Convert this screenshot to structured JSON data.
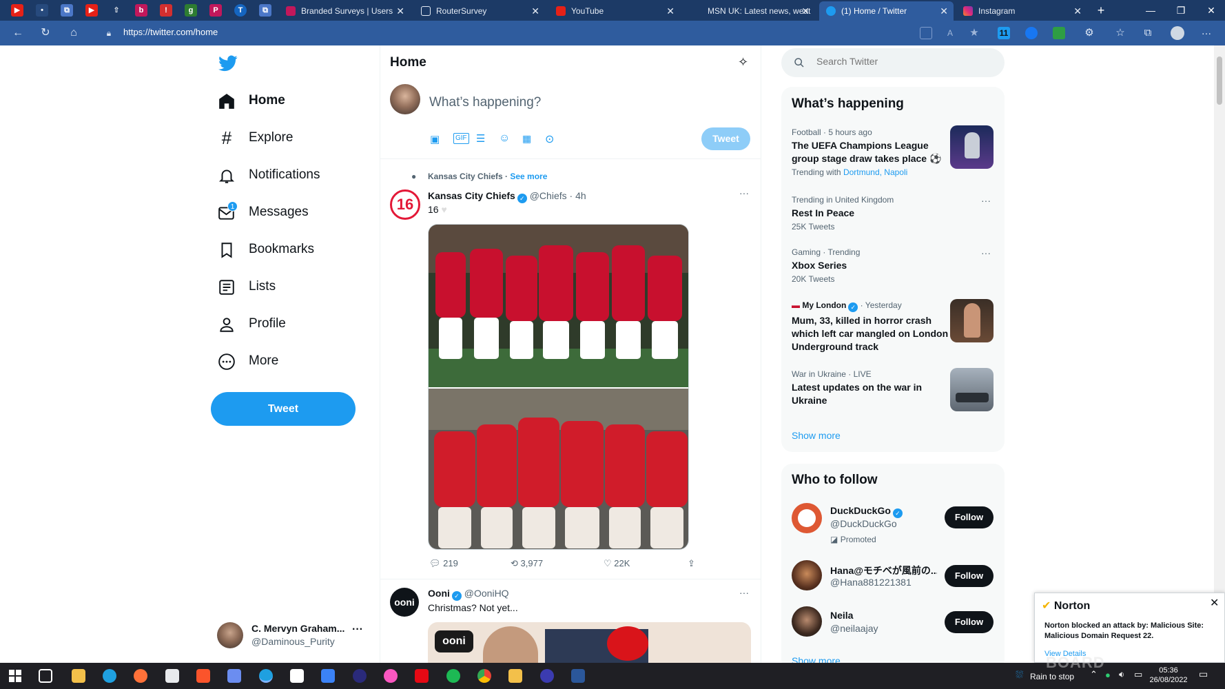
{
  "browser": {
    "tabs": [
      {
        "title": "Branded Surveys | Users",
        "icon": "branded-surveys-icon"
      },
      {
        "title": "RouterSurvey",
        "icon": "document-icon"
      },
      {
        "title": "YouTube",
        "icon": "youtube-icon"
      },
      {
        "title": "MSN UK: Latest news, weat",
        "icon": "msn-icon"
      },
      {
        "title": "(1) Home / Twitter",
        "icon": "twitter-icon",
        "active": true
      },
      {
        "title": "Instagram",
        "icon": "instagram-icon"
      }
    ],
    "url": "https://twitter.com/home"
  },
  "sidebar": {
    "nav": [
      {
        "label": "Home",
        "icon": "home-icon"
      },
      {
        "label": "Explore",
        "icon": "hashtag-icon"
      },
      {
        "label": "Notifications",
        "icon": "bell-icon"
      },
      {
        "label": "Messages",
        "icon": "envelope-icon",
        "badge": "1"
      },
      {
        "label": "Bookmarks",
        "icon": "bookmark-icon"
      },
      {
        "label": "Lists",
        "icon": "list-icon"
      },
      {
        "label": "Profile",
        "icon": "person-icon"
      },
      {
        "label": "More",
        "icon": "more-circle-icon"
      }
    ],
    "tweet_button": "Tweet",
    "account": {
      "name": "C. Mervyn Graham...",
      "handle": "@Daminous_Purity"
    }
  },
  "main": {
    "title": "Home",
    "compose": {
      "placeholder": "What’s happening?",
      "button": "Tweet"
    },
    "social_context": {
      "text": "Kansas City Chiefs",
      "link": "See more"
    },
    "tweets": [
      {
        "name": "Kansas City Chiefs",
        "handle": "@Chiefs",
        "time": "4h",
        "text": "16",
        "replies": "219",
        "retweets": "3,977",
        "likes": "22K"
      },
      {
        "name": "Ooni",
        "handle": "@OoniHQ",
        "text": "Christmas? Not yet..."
      }
    ]
  },
  "right": {
    "search_placeholder": "Search Twitter",
    "happening_title": "What’s happening",
    "trends": [
      {
        "meta": "Football · 5 hours ago",
        "title": "The UEFA Champions League group stage draw takes place ⚽",
        "sub_prefix": "Trending with",
        "sub_links": "Dortmund, Napoli"
      },
      {
        "meta": "Trending in United Kingdom",
        "title": "Rest In Peace",
        "sub": "25K Tweets"
      },
      {
        "meta": "Gaming · Trending",
        "title": "Xbox Series",
        "sub": "20K Tweets"
      },
      {
        "meta_source": "My London",
        "meta_time": "· Yesterday",
        "title": "Mum, 33, killed in horror crash which left car mangled on London Underground track"
      },
      {
        "meta": "War in Ukraine · LIVE",
        "title": "Latest updates on the war in Ukraine"
      }
    ],
    "show_more": "Show more",
    "follow_title": "Who to follow",
    "follow": [
      {
        "name": "DuckDuckGo",
        "handle": "@DuckDuckGo",
        "promoted": "Promoted",
        "button": "Follow"
      },
      {
        "name": "Hana@モチベが風前の...",
        "handle": "@Hana881221381",
        "button": "Follow"
      },
      {
        "name": "Neila",
        "handle": "@neilaajay",
        "button": "Follow"
      }
    ],
    "follow_show_more": "Show more"
  },
  "norton": {
    "brand": "Norton",
    "message": "Norton blocked an attack by: Malicious Site: Malicious Domain Request 22.",
    "link": "View Details"
  },
  "taskbar": {
    "weather": "Rain to stop",
    "time": "05:36",
    "date": "26/08/2022",
    "watermark": "BOARD"
  },
  "colors": {
    "accent": "#1d9bf0",
    "tabstrip": "#1c3a66",
    "addressbar": "#2f5c9e"
  }
}
